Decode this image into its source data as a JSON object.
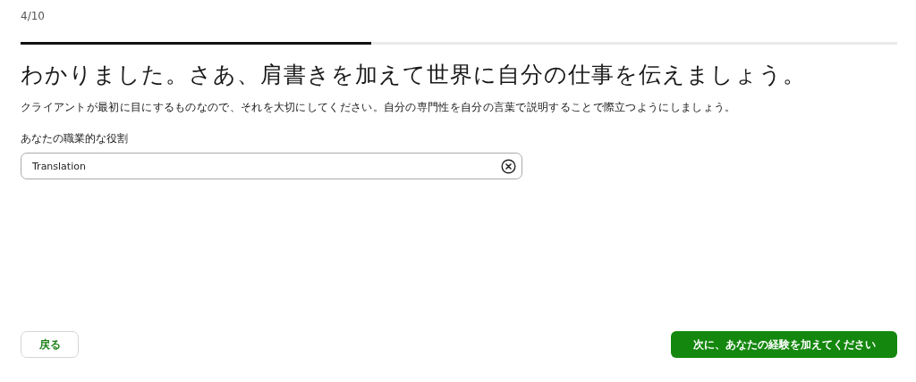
{
  "step": "4/10",
  "progress": {
    "level": 0.4
  },
  "heading": "わかりました。さあ、肩書きを加えて世界に自分の仕事を伝えましょう。",
  "description": "クライアントが最初に目にするものなので、それを大切にしてください。自分の専門性を自分の言葉で説明することで際立つようにしましょう。",
  "field": {
    "label": "あなたの職業的な役割",
    "value": "Translation"
  },
  "buttons": {
    "back": "戻る",
    "next": "次に、あなたの経験を加えてください"
  }
}
